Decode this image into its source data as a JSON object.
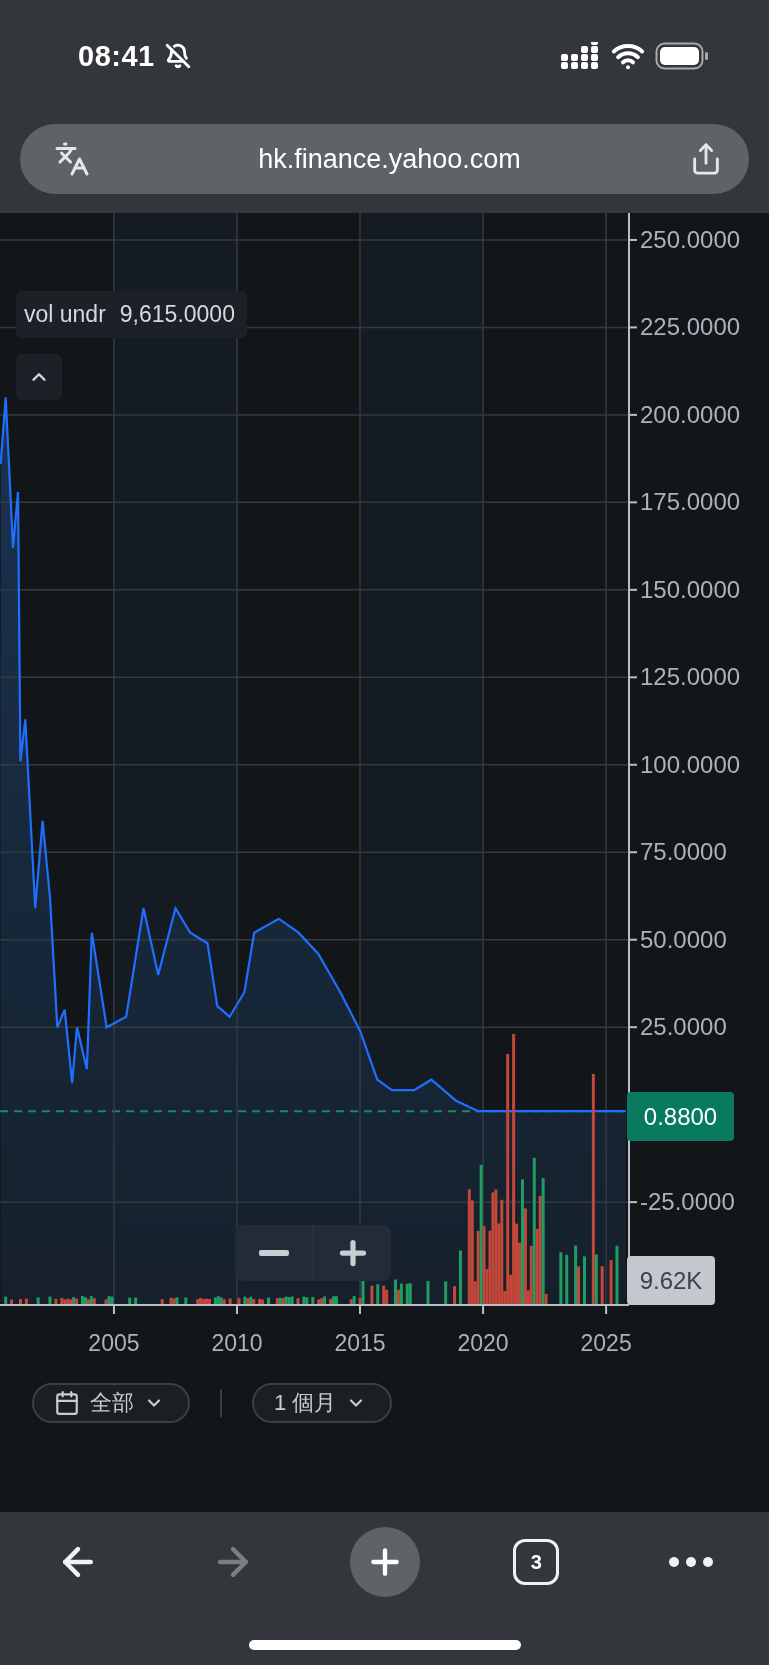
{
  "status_bar": {
    "time": "08:41",
    "silent": true
  },
  "address_bar": {
    "url": "hk.finance.yahoo.com"
  },
  "chart": {
    "legend": {
      "value": "9,615.0000"
    },
    "last_price_tag": "0.8800",
    "volume_tag": "9.62K",
    "chart_data": {
      "type": "line",
      "grid": true,
      "xlim": [
        2000.37,
        2025.93
      ],
      "ylim": [
        -54.4,
        257.7
      ],
      "xticks": [
        2005,
        2010,
        2015,
        2020,
        2025
      ],
      "yticks": [
        {
          "value": 250,
          "label": "250.0000"
        },
        {
          "value": 225,
          "label": "225.0000"
        },
        {
          "value": 200,
          "label": "200.0000"
        },
        {
          "value": 175,
          "label": "175.0000"
        },
        {
          "value": 150,
          "label": "150.0000"
        },
        {
          "value": 125,
          "label": "125.0000"
        },
        {
          "value": 100,
          "label": "100.0000"
        },
        {
          "value": 75,
          "label": "75.0000"
        },
        {
          "value": 50,
          "label": "50.0000"
        },
        {
          "value": 25,
          "label": "25.0000"
        },
        {
          "value": -25,
          "label": "-25.0000"
        }
      ],
      "x": [
        2000.4,
        2000.6,
        2000.9,
        2001.1,
        2001.2,
        2001.4,
        2001.8,
        2002.1,
        2002.4,
        2002.7,
        2003.0,
        2003.3,
        2003.5,
        2003.9,
        2004.1,
        2004.7,
        2005.5,
        2006.2,
        2006.8,
        2007.5,
        2008.1,
        2008.8,
        2009.2,
        2009.7,
        2010.3,
        2010.7,
        2011.7,
        2012.5,
        2013.3,
        2014.2,
        2015.0,
        2015.7,
        2016.3,
        2017.2,
        2017.9,
        2018.9,
        2019.8,
        2022.0,
        2025.8
      ],
      "series": [
        {
          "name": "vol undr",
          "color": "#1f6fff",
          "values": [
            186,
            205,
            162,
            178,
            101,
            113,
            59,
            84,
            62,
            25,
            30,
            9,
            25,
            13,
            52,
            25,
            28,
            59,
            40,
            59,
            52,
            49,
            31,
            28,
            35,
            52,
            56,
            52,
            46,
            35,
            24,
            10,
            7,
            7,
            10,
            4,
            1,
            1,
            1
          ]
        }
      ]
    }
  },
  "controls": [
    {
      "kind": "range",
      "label": "全部"
    },
    {
      "kind": "interval",
      "label": "1 個月"
    }
  ],
  "toolbar": [
    {
      "kind": "back",
      "disabled": false
    },
    {
      "kind": "forward",
      "disabled": true
    },
    {
      "kind": "new_tab",
      "disabled": false
    },
    {
      "kind": "tabs",
      "label": "3",
      "disabled": false
    },
    {
      "kind": "more",
      "disabled": false
    }
  ]
}
